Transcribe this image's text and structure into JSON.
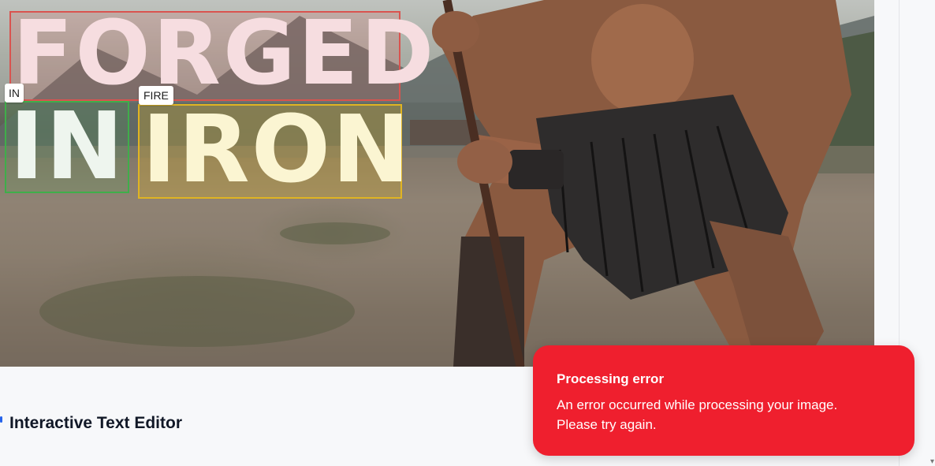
{
  "preview": {
    "detections": [
      {
        "text": "FORGED",
        "box_color": "#d9534f"
      },
      {
        "text": "IN",
        "label": "IN",
        "box_color": "#3fae4a"
      },
      {
        "text": "IRON",
        "label": "FIRE",
        "box_color": "#e0b422"
      }
    ]
  },
  "editor": {
    "title": "Interactive Text Editor"
  },
  "toast": {
    "title": "Processing error",
    "message": "An error occurred while processing your image. Please try again.",
    "color": "#ef1f2e"
  }
}
